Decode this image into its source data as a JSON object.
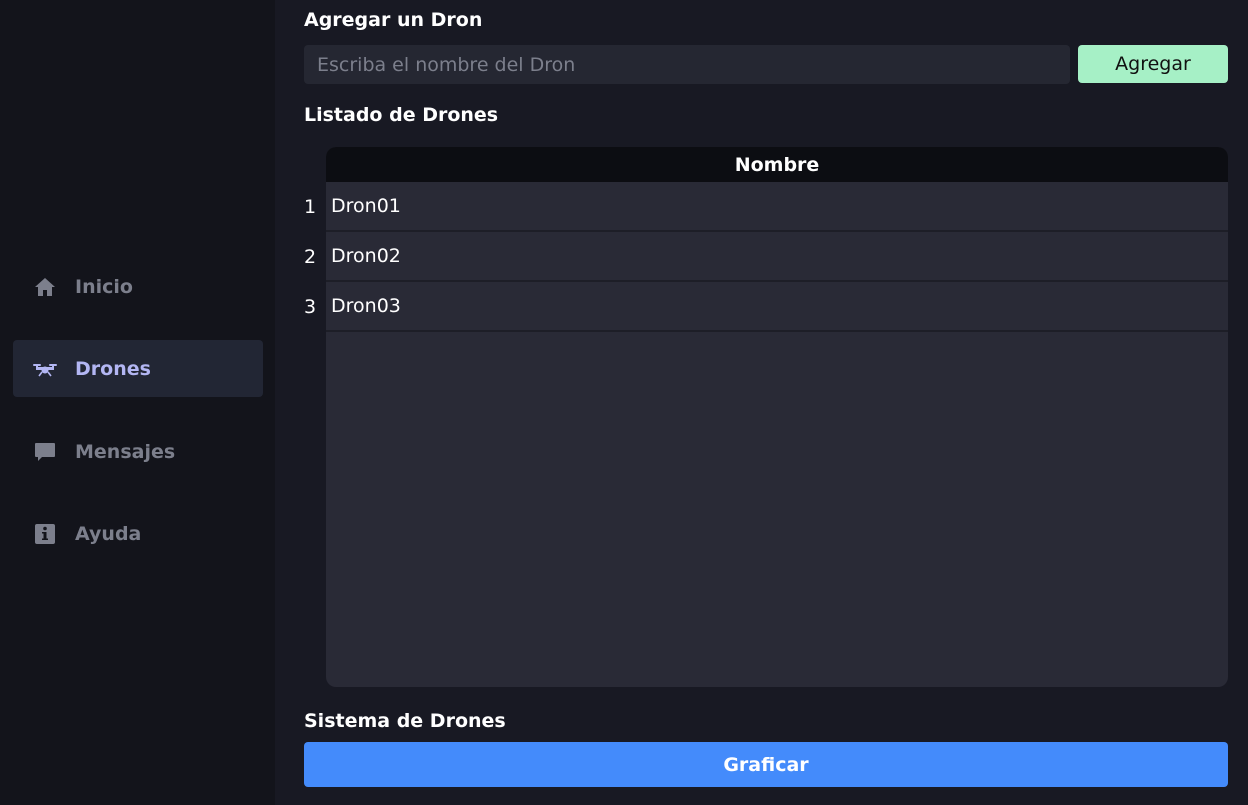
{
  "sidebar": {
    "items": [
      {
        "label": "Inicio",
        "icon": "home-icon"
      },
      {
        "label": "Drones",
        "icon": "drone-icon",
        "active": true
      },
      {
        "label": "Mensajes",
        "icon": "chat-icon"
      },
      {
        "label": "Ayuda",
        "icon": "info-icon"
      }
    ]
  },
  "add_section": {
    "title": "Agregar un Dron",
    "input_placeholder": "Escriba el nombre del Dron",
    "input_value": "",
    "button_label": "Agregar"
  },
  "list_section": {
    "title": "Listado de Drones",
    "column_header": "Nombre",
    "rows": [
      {
        "index": "1",
        "name": "Dron01"
      },
      {
        "index": "2",
        "name": "Dron02"
      },
      {
        "index": "3",
        "name": "Dron03"
      }
    ]
  },
  "system_section": {
    "title": "Sistema de Drones",
    "button_label": "Graficar"
  },
  "colors": {
    "background": "#181923",
    "sidebar": "#13141b",
    "accent_green": "#a6f0c6",
    "accent_blue": "#448bfb",
    "active_nav_text": "#b3b6f3"
  }
}
